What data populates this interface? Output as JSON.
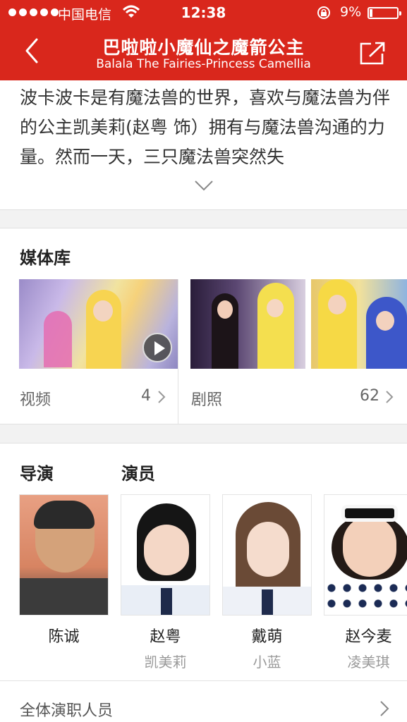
{
  "status_bar": {
    "carrier": "中国电信",
    "time": "12:38",
    "battery": "9%",
    "battery_level": 0.09
  },
  "nav": {
    "title": "巴啦啦小魔仙之魔箭公主",
    "subtitle": "Balala The Fairies-Princess Camellia",
    "back_icon": "chevron-left-icon",
    "share_icon": "share-icon"
  },
  "synopsis": {
    "text": "波卡波卡是有魔法兽的世界，喜欢与魔法兽为伴的公主凯美莉(赵粤 饰）拥有与魔法兽沟通的力量。然而一天，三只魔法兽突然失",
    "expand_icon": "chevron-down-icon"
  },
  "media": {
    "title": "媒体库",
    "video": {
      "label": "视频",
      "count": "4"
    },
    "stills": {
      "label": "剧照",
      "count": "62"
    }
  },
  "people": {
    "director_title": "导演",
    "cast_title": "演员",
    "items": [
      {
        "name": "陈诚",
        "role": ""
      },
      {
        "name": "赵粤",
        "role": "凯美莉"
      },
      {
        "name": "戴萌",
        "role": "小蓝"
      },
      {
        "name": "赵今麦",
        "role": "凌美琪"
      }
    ],
    "all_cast": "全体演职人员"
  },
  "colors": {
    "accent": "#d9271c",
    "divider": "#e2e2e2",
    "muted_text": "#999999"
  }
}
